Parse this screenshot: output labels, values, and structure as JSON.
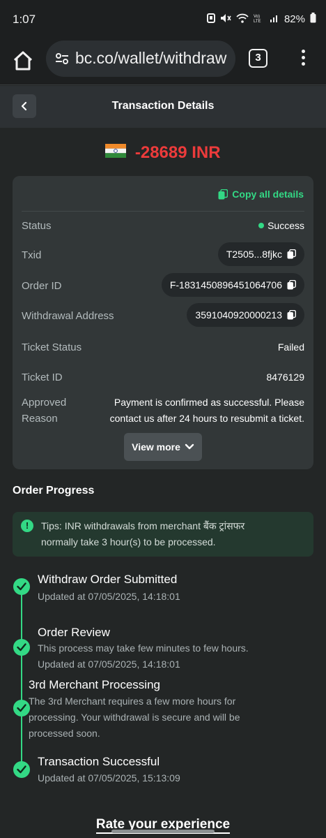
{
  "status_bar": {
    "time": "1:07",
    "battery": "82%"
  },
  "browser": {
    "url": "bc.co/wallet/withdraw",
    "tab_count": "3"
  },
  "header": {
    "title": "Transaction Details"
  },
  "amount": {
    "text": "-28689 INR",
    "color": "#ec3b3b"
  },
  "details": {
    "copy_all": "Copy all details",
    "status": {
      "label": "Status",
      "value": "Success"
    },
    "txid": {
      "label": "Txid",
      "value": "T2505...8fjkc"
    },
    "order_id": {
      "label": "Order ID",
      "value": "F-1831450896451064706"
    },
    "withdrawal_address": {
      "label": "Withdrawal Address",
      "value": "3591040920000213"
    },
    "ticket_status": {
      "label": "Ticket Status",
      "value": "Failed"
    },
    "ticket_id": {
      "label": "Ticket ID",
      "value": "8476129"
    },
    "approved_reason": {
      "label_line1": "Approved",
      "label_line2": "Reason",
      "value_line1": "Payment is confirmed as successful. Please",
      "value_line2": "contact us after 24 hours to resubmit a ticket."
    },
    "view_more": "View more"
  },
  "order_progress": {
    "title": "Order Progress",
    "tip_line1": "Tips: INR withdrawals from merchant बैंक ट्रांसफर",
    "tip_line2": "normally take 3 hour(s) to be processed.",
    "steps": [
      {
        "title": "Withdraw Order Submitted",
        "lines": [
          "Updated at 07/05/2025, 14:18:01"
        ]
      },
      {
        "title": "Order Review",
        "lines": [
          "This process may take few minutes to few hours.",
          "Updated at 07/05/2025, 14:18:01"
        ]
      },
      {
        "title": "3rd Merchant Processing",
        "lines": [
          "The 3rd Merchant requires a few more hours for",
          "processing. Your withdrawal is secure and will be",
          "processed soon."
        ]
      },
      {
        "title": "Transaction Successful",
        "lines": [
          "Updated at 07/05/2025, 15:13:09"
        ]
      }
    ]
  },
  "rate_experience": "Rate your experience",
  "colors": {
    "accent_green": "#33d985",
    "background": "#232626",
    "card": "#323738"
  }
}
